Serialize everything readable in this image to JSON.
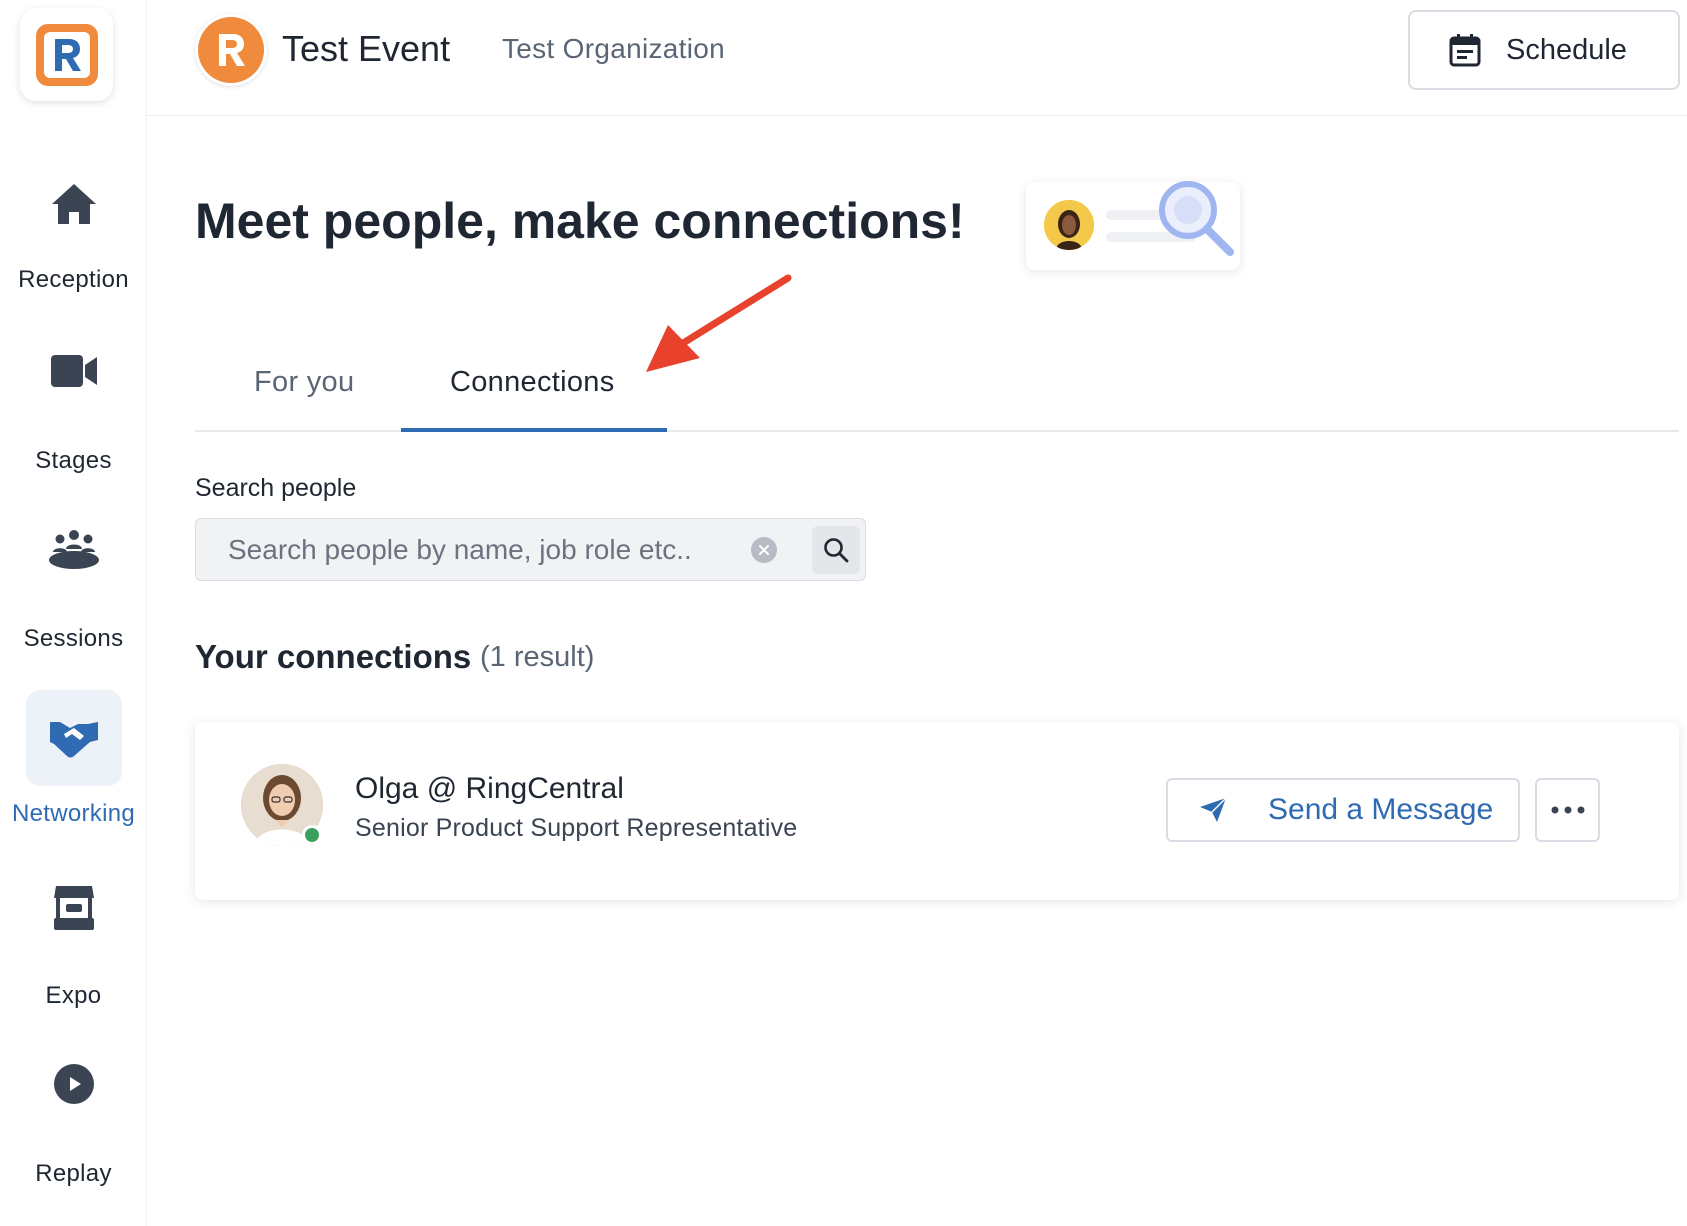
{
  "sidebar": {
    "items": [
      {
        "label": "Reception",
        "icon": "home-icon",
        "active": false
      },
      {
        "label": "Stages",
        "icon": "video-camera-icon",
        "active": false
      },
      {
        "label": "Sessions",
        "icon": "people-group-icon",
        "active": false
      },
      {
        "label": "Networking",
        "icon": "handshake-icon",
        "active": true
      },
      {
        "label": "Expo",
        "icon": "booth-icon",
        "active": false
      },
      {
        "label": "Replay",
        "icon": "play-icon",
        "active": false
      }
    ]
  },
  "header": {
    "event_title": "Test Event",
    "organization": "Test Organization",
    "schedule_label": "Schedule"
  },
  "main": {
    "title": "Meet people, make connections!",
    "tabs": [
      {
        "label": "For you",
        "active": false
      },
      {
        "label": "Connections",
        "active": true
      }
    ],
    "search": {
      "label": "Search people",
      "placeholder": "Search people by name, job role etc.."
    },
    "connections": {
      "title": "Your connections",
      "count_text": "(1 result)",
      "items": [
        {
          "name": "Olga @ RingCentral",
          "role": "Senior Product Support Representative",
          "online": true,
          "message_label": "Send a Message"
        }
      ]
    }
  },
  "colors": {
    "accent": "#2f6bb3",
    "brand_orange": "#f08a3c",
    "annotation_arrow": "#e8412c",
    "online": "#3aa05b"
  }
}
